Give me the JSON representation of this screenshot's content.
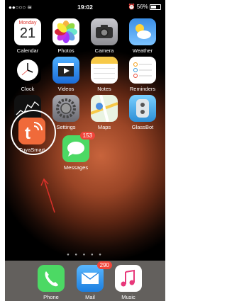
{
  "status": {
    "time": "19:02",
    "battery": "56%",
    "battery_fraction": 0.56
  },
  "apps": [
    {
      "label": "Calendar",
      "weekday": "Monday",
      "day": "21"
    },
    {
      "label": "Photos"
    },
    {
      "label": "Camera"
    },
    {
      "label": "Weather"
    },
    {
      "label": "Clock"
    },
    {
      "label": "Videos"
    },
    {
      "label": "Notes"
    },
    {
      "label": "Reminders"
    },
    {
      "label": "Stocks"
    },
    {
      "label": "Settings"
    },
    {
      "label": "Maps"
    },
    {
      "label": "GlassBot"
    },
    {
      "label": "TuyaSmart"
    },
    {
      "label": "Messages",
      "badge": "153"
    }
  ],
  "page_dots": "● ● ● ● ●",
  "dock": [
    {
      "label": "Phone"
    },
    {
      "label": "Mail",
      "badge": "290"
    },
    {
      "label": "Music"
    }
  ],
  "colors": {
    "tuya": "#f06a3a",
    "messages": "#4cd964",
    "badge": "#f0453a",
    "annotation": "#d9302a"
  }
}
